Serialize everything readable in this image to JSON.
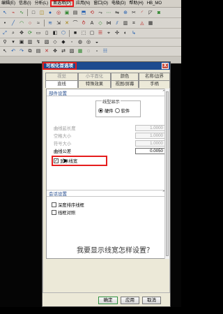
{
  "window": {
    "title": "HB_MO"
  },
  "menu": {
    "items": [
      "编辑(E)",
      "信息(I)",
      "分析(L)",
      "首选项(P)",
      "应用(N)",
      "窗口(O)",
      "电极(D)",
      "帮助(H)"
    ],
    "active_index": 3,
    "accent_color": "#e51d1d"
  },
  "dialog": {
    "title": "可视化首选项",
    "close_label": "X",
    "tabs_row_1": [
      "视觉",
      "小平面化",
      "颜色",
      "名称/边界"
    ],
    "tabs_row_2": [
      "直线",
      "特殊效果",
      "视图/屏幕",
      "手柄"
    ],
    "selected_tab": "直线",
    "component_settings": {
      "title": "部件设置",
      "line_display_label": "线型显示",
      "hardware_label": "硬件",
      "software_label": "软件",
      "hardware_selected": true,
      "fields": [
        {
          "label": "曲线延长度",
          "value": "1.0000",
          "enabled": false
        },
        {
          "label": "空格大小",
          "value": "1.0000",
          "enabled": false
        },
        {
          "label": "符号大小",
          "value": "1.0000",
          "enabled": false
        },
        {
          "label": "曲线公差",
          "value": "0.0050",
          "enabled": true
        }
      ],
      "show_linewidth_label": "显示线宽",
      "show_linewidth_checked": true
    },
    "session_settings": {
      "title": "会话设置",
      "options": [
        {
          "label": "深度排序线框",
          "checked": false
        },
        {
          "label": "线框对照",
          "checked": false
        }
      ]
    },
    "question": "我要显示线宽怎样设置？",
    "buttons": {
      "ok": "确定",
      "apply": "应用",
      "cancel": "取消"
    }
  },
  "icons": {
    "close": "close-icon",
    "collapse": "chevron-up-icon",
    "cursor": "arrow-cursor-icon"
  },
  "colors": {
    "titlebar": "#1d4b8f",
    "highlight": "#e51d1d",
    "dialog_bg": "#ece9d8"
  }
}
